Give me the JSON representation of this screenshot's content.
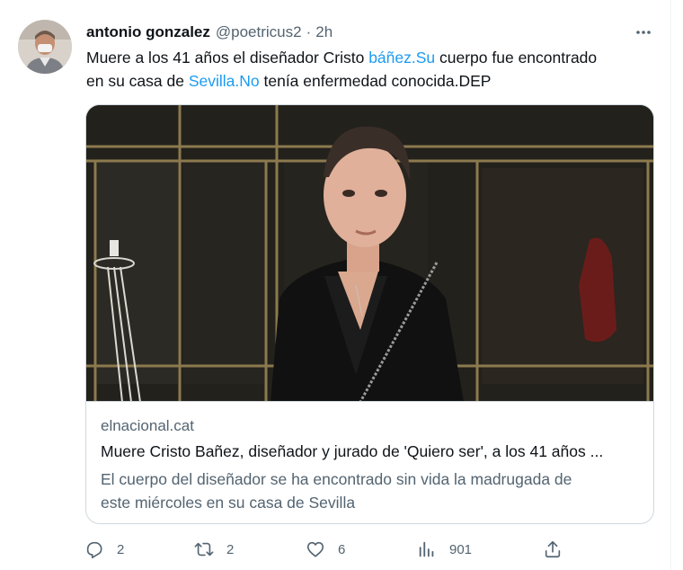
{
  "tweet": {
    "author_name": "antonio gonzalez",
    "handle": "@poetricus2",
    "separator": "·",
    "time": "2h",
    "text_part1": "Muere a los 41 años el diseñador Cristo ",
    "link1": "báñez.Su",
    "text_part2": " cuerpo fue encontrado",
    "text_part3": "en su casa de ",
    "link2": "Sevilla.No",
    "text_part4": " tenía enfermedad conocida.DEP"
  },
  "card": {
    "domain": "elnacional.cat",
    "title": "Muere Cristo Bañez, diseñador y jurado de 'Quiero ser', a los 41 años ...",
    "description_line1": "El cuerpo del diseñador se ha encontrado sin vida la madrugada de",
    "description_line2": "este miércoles en su casa de Sevilla"
  },
  "actions": {
    "replies": "2",
    "retweets": "2",
    "likes": "6",
    "views": "901"
  },
  "icons": {
    "more": "more-dots-icon",
    "reply": "reply-icon",
    "retweet": "retweet-icon",
    "like": "heart-icon",
    "views": "views-chart-icon",
    "share": "share-icon"
  },
  "colors": {
    "link": "#1d9bf0",
    "secondary_text": "#536471",
    "border": "#cfd9de"
  }
}
